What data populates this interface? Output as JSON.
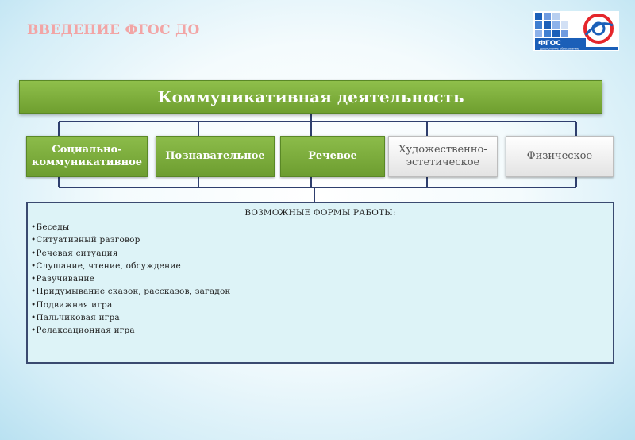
{
  "slide": {
    "title": "ВВЕДЕНИЕ ФГОС ДО"
  },
  "logo": {
    "text": "ФГОС",
    "caption": "Дошкольное образование",
    "icon": "fgos-logo-icon"
  },
  "header": {
    "title": "Коммуникативная деятельность"
  },
  "categories": [
    {
      "label": "Социально-\nкоммуникативное",
      "style": "green"
    },
    {
      "label": "Познавательное",
      "style": "green"
    },
    {
      "label": "Речевое",
      "style": "green"
    },
    {
      "label": "Художественно-\nэстетическое",
      "style": "grey"
    },
    {
      "label": "Физическое",
      "style": "grey"
    }
  ],
  "forms": {
    "title": "ВОЗМОЖНЫЕ ФОРМЫ РАБОТЫ:",
    "items": [
      "Беседы",
      "Ситуативный разговор",
      "Речевая ситуация",
      "Слушание, чтение, обсуждение",
      "Разучивание",
      "Придумывание сказок, рассказов, загадок",
      "Подвижная игра",
      "Пальчиковая игра",
      "Релаксационная игра"
    ]
  },
  "colors": {
    "title": "#f2a5a5",
    "green": "#7aab3a",
    "connector": "#2f3f6e",
    "panel_bg": "#ddf3f7",
    "panel_border": "#3a4a70",
    "logo_blue": "#1b5fb8",
    "logo_red": "#e5262b"
  }
}
